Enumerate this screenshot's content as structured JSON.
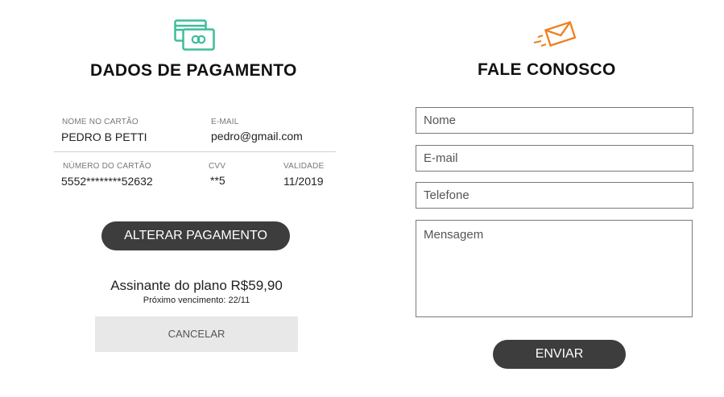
{
  "payment": {
    "icon": "credit-card-icon",
    "title": "DADOS DE PAGAMENTO",
    "name_label": "NOME NO CARTÃO",
    "name_value": "PEDRO B PETTI",
    "email_label": "E-MAIL",
    "email_value": "pedro@gmail.com",
    "card_label": "NÚMERO DO CARTÃO",
    "card_value": "5552********52632",
    "cvv_label": "CVV",
    "cvv_value": "**5",
    "expiry_label": "VALIDADE",
    "expiry_value": "11/2019",
    "change_button": "ALTERAR PAGAMENTO",
    "plan_text": "Assinante do plano R$59,90",
    "next_due": "Próximo vencimento: 22/11",
    "cancel_button": "CANCELAR",
    "accent_color": "#3dbd9a"
  },
  "contact": {
    "icon": "envelope-icon",
    "title": "FALE CONOSCO",
    "name_placeholder": "Nome",
    "email_placeholder": "E-mail",
    "phone_placeholder": "Telefone",
    "message_placeholder": "Mensagem",
    "send_button": "ENVIAR",
    "accent_color": "#f07f1e"
  }
}
